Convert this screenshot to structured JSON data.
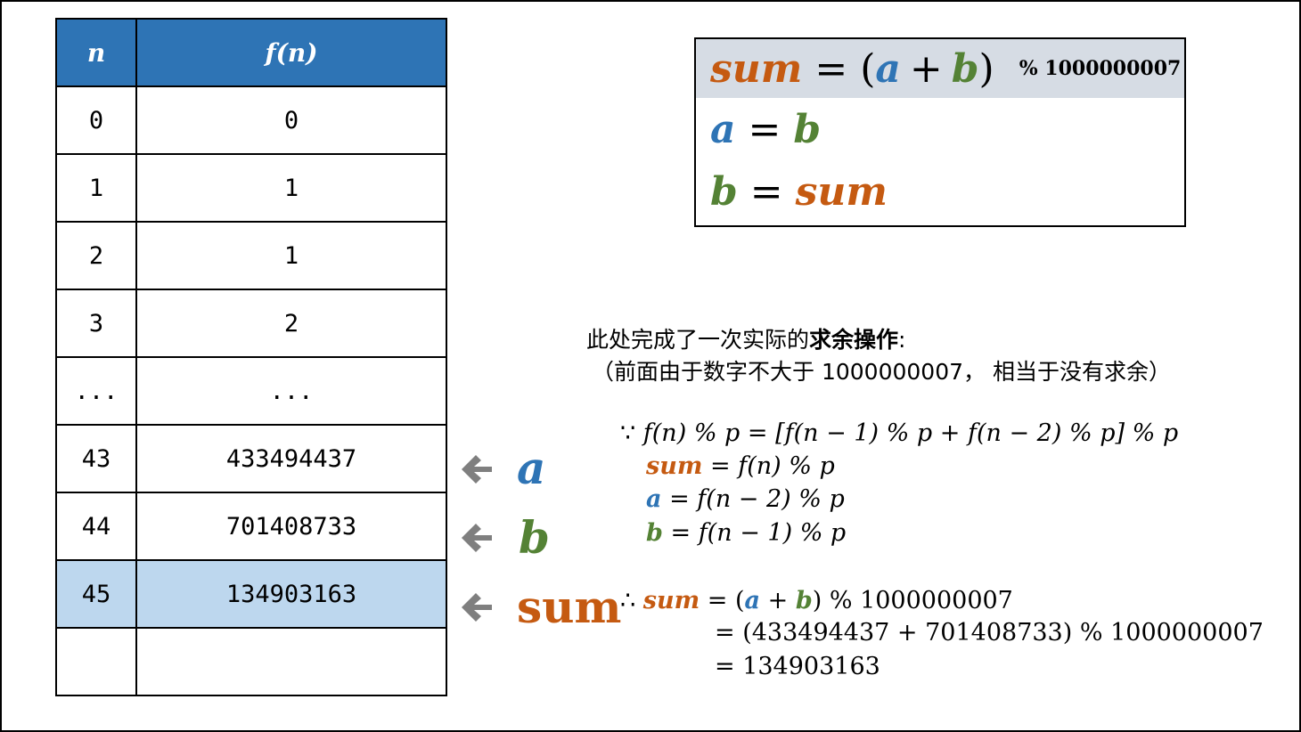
{
  "table": {
    "headers": {
      "n": "n",
      "fn": "f(n)"
    },
    "rows": [
      {
        "n": "0",
        "fn": "0"
      },
      {
        "n": "1",
        "fn": "1"
      },
      {
        "n": "2",
        "fn": "1"
      },
      {
        "n": "3",
        "fn": "2"
      },
      {
        "n": "...",
        "fn": "..."
      },
      {
        "n": "43",
        "fn": "433494437"
      },
      {
        "n": "44",
        "fn": "701408733"
      },
      {
        "n": "45",
        "fn": "134903163"
      },
      {
        "n": "",
        "fn": ""
      }
    ],
    "highlight_row": 7,
    "header_color": "#2e74b5",
    "highlight_color": "#bdd7ee"
  },
  "labels": {
    "a": "a",
    "b": "b",
    "sum": "sum"
  },
  "colors": {
    "a": "#2e74b5",
    "b": "#548235",
    "sum": "#c55a11",
    "arrow": "#7f7f7f"
  },
  "formula_box": {
    "line1": {
      "sum": "sum",
      "eq": "=",
      "lparen": "(",
      "a": "a",
      "plus": "+",
      "b": "b",
      "rparen": ")",
      "mod": "% 1000000007"
    },
    "line2": {
      "lhs": "a",
      "eq": "=",
      "rhs": "b"
    },
    "line3": {
      "lhs": "b",
      "eq": "=",
      "rhs": "sum"
    }
  },
  "notes": {
    "line1_plain": "此处完成了一次实际的",
    "line1_bold": "求余操作",
    "line1_tail": ":",
    "line2": "（前面由于数字不大于 1000000007， 相当于没有求余）"
  },
  "derivation": {
    "because": "∵",
    "eq1": "f(n) % p = [f(n − 1) % p + f(n − 2) % p] % p",
    "sum_def_lhs": "sum",
    "sum_def_rhs": "= f(n) % p",
    "a_def_lhs": "a",
    "a_def_rhs": "= f(n − 2) % p",
    "b_def_lhs": "b",
    "b_def_rhs": "= f(n − 1) % p",
    "therefore": "∴",
    "res_sum": "sum",
    "res_eq": "= (",
    "res_a": "a",
    "res_plus": " + ",
    "res_b": "b",
    "res_tail": ") % 1000000007",
    "res2": "= (433494437 + 701408733) % 1000000007",
    "res3": "= 134903163"
  }
}
